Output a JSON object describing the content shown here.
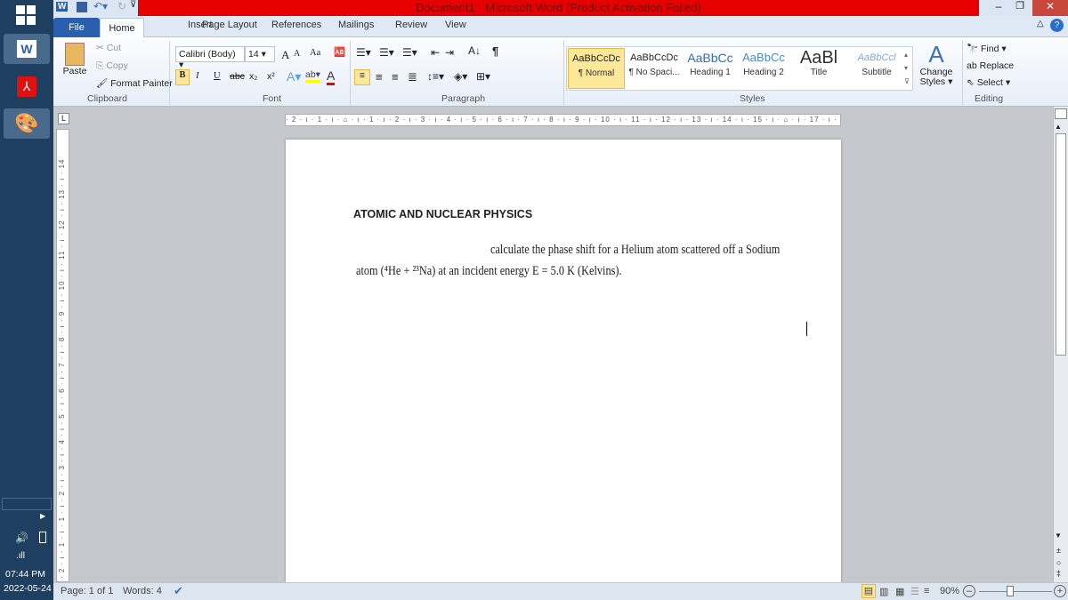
{
  "window": {
    "title": "Document1  -  Microsoft Word (Product Activation Failed)"
  },
  "tabs": [
    "File",
    "Home",
    "Insert",
    "Page Layout",
    "References",
    "Mailings",
    "Review",
    "View"
  ],
  "clipboard": {
    "paste": "Paste",
    "cut": "Cut",
    "copy": "Copy",
    "format_painter": "Format Painter",
    "group": "Clipboard"
  },
  "font": {
    "name": "Calibri (Body)",
    "size": "14",
    "group": "Font",
    "bold": "B",
    "italic": "I",
    "underline": "U",
    "strike": "abc",
    "sub": "x₂",
    "sup": "x²",
    "grow": "A",
    "shrink": "A",
    "case": "Aa"
  },
  "paragraph": {
    "group": "Paragraph"
  },
  "styles": {
    "group": "Styles",
    "items": [
      {
        "sample": "AaBbCcDc",
        "label": "¶ Normal"
      },
      {
        "sample": "AaBbCcDc",
        "label": "¶ No Spaci..."
      },
      {
        "sample": "AaBbCc",
        "label": "Heading 1"
      },
      {
        "sample": "AaBbCc",
        "label": "Heading 2"
      },
      {
        "sample": "AaBl",
        "label": "Title"
      },
      {
        "sample": "AaBbCcl",
        "label": "Subtitle"
      }
    ],
    "change": "Change Styles"
  },
  "editing": {
    "group": "Editing",
    "find": "Find",
    "replace": "Replace",
    "select": "Select"
  },
  "ruler": "· 2 · ı · 1 · ı · ⌂ · ı · 1 · ı · 2 · ı · 3 · ı · 4 · ı · 5 · ı · 6 · ı · 7 · ı · 8 · ı · 9 · ı · 10 · ı · 11 · ı · 12 · ı · 13 · ı · 14 · ı · 15 · ı · ⌂ · ı · 17 · ı · 18 ·",
  "vruler": "· 2 · ı · 1 · ı · 1 · ı · 2 · ı · 3 · ı · 4 · ı · 5 · ı · 6 · ı · 7 · ı · 8 · ı · 9 · ı · 10 · ı · 11 · ı · 12 · ı · 13 · ı · 14",
  "document": {
    "heading": "ATOMIC AND NUCLEAR PHYSICS",
    "line1": "calculate the phase shift for a Helium atom scattered off a Sodium",
    "line2": "atom (⁴He + ²³Na) at an incident energy E = 5.0 K (Kelvins)."
  },
  "status": {
    "page": "Page: 1 of 1",
    "words": "Words: 4",
    "zoom": "90%",
    "zoom_percent": 90
  },
  "clock": {
    "time": "07:44 PM",
    "date": "2022-05-24"
  },
  "colors": {
    "title_bar": "#e60000",
    "taskbar": "#1f3f60",
    "file_tab": "#2a5fb0"
  }
}
